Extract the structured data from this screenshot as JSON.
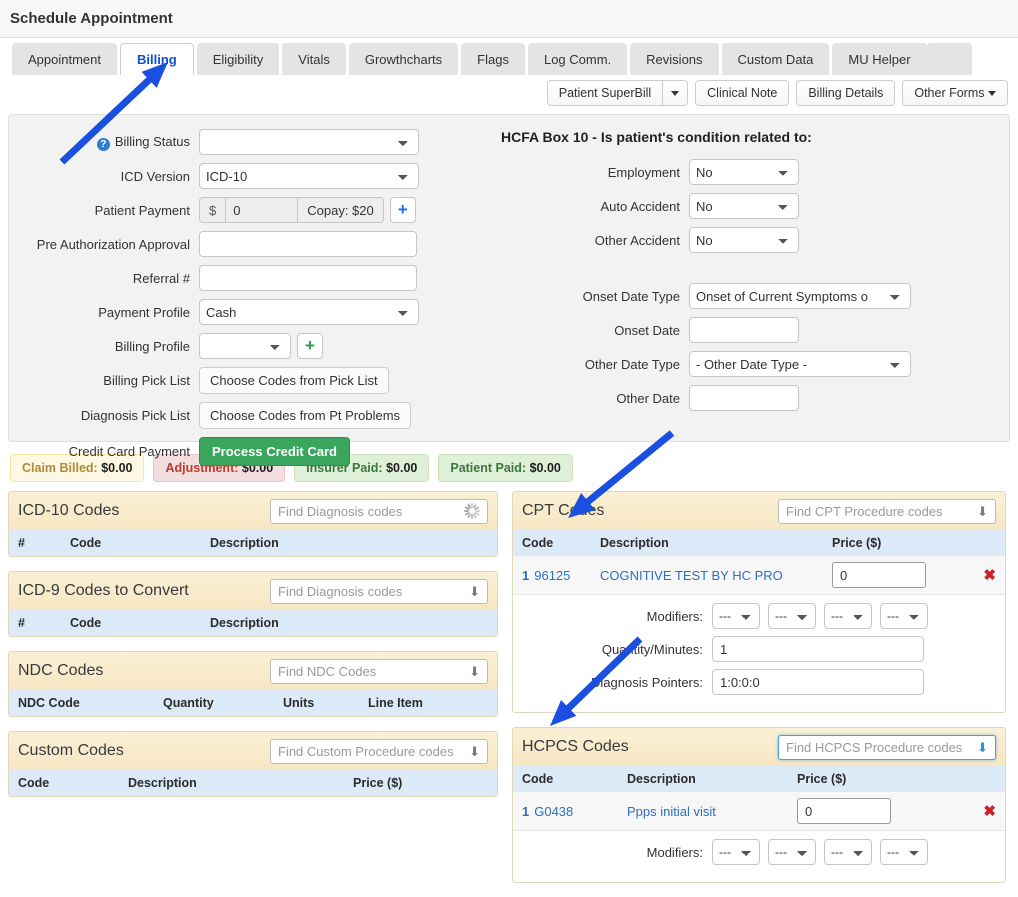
{
  "window": {
    "title": "Schedule Appointment"
  },
  "tabs": [
    {
      "label": "Appointment",
      "active": false
    },
    {
      "label": "Billing",
      "active": true
    },
    {
      "label": "Eligibility",
      "active": false
    },
    {
      "label": "Vitals",
      "active": false
    },
    {
      "label": "Growthcharts",
      "active": false
    },
    {
      "label": "Flags",
      "active": false
    },
    {
      "label": "Log Comm.",
      "active": false
    },
    {
      "label": "Revisions",
      "active": false
    },
    {
      "label": "Custom Data",
      "active": false
    },
    {
      "label": "MU Helper",
      "active": false
    }
  ],
  "toolbar": {
    "superbill_label": "Patient SuperBill",
    "superbill_caret": "▼",
    "clinical_note_label": "Clinical Note",
    "billing_details_label": "Billing Details",
    "other_forms_label": "Other Forms",
    "other_forms_caret": "▼"
  },
  "billing_form": {
    "help_icon_glyph": "?",
    "billing_status": {
      "label": "Billing Status",
      "value": ""
    },
    "icd_version": {
      "label": "ICD Version",
      "value": "ICD-10"
    },
    "patient_payment": {
      "label": "Patient Payment",
      "currency": "$",
      "value": "0",
      "copay_text": "Copay: $20",
      "add_glyph": "+"
    },
    "pre_auth": {
      "label": "Pre Authorization Approval",
      "value": ""
    },
    "referral": {
      "label": "Referral #",
      "value": ""
    },
    "payment_profile": {
      "label": "Payment Profile",
      "value": "Cash"
    },
    "billing_profile": {
      "label": "Billing Profile",
      "value": "",
      "add_glyph": "+"
    },
    "billing_pick_list": {
      "label": "Billing Pick List",
      "button": "Choose Codes from Pick List"
    },
    "diagnosis_pick_list": {
      "label": "Diagnosis Pick List",
      "button": "Choose Codes from Pt Problems"
    },
    "credit_card": {
      "label": "Credit Card Payment",
      "button": "Process Credit Card"
    }
  },
  "hcfa": {
    "title": "HCFA Box 10 - Is patient's condition related to:",
    "employment": {
      "label": "Employment",
      "value": "No"
    },
    "auto_accident": {
      "label": "Auto Accident",
      "value": "No"
    },
    "other_accident": {
      "label": "Other Accident",
      "value": "No"
    },
    "onset_date_type": {
      "label": "Onset Date Type",
      "value": "Onset of Current Symptoms o"
    },
    "onset_date": {
      "label": "Onset Date",
      "value": ""
    },
    "other_date_type": {
      "label": "Other Date Type",
      "value": "- Other Date Type -"
    },
    "other_date": {
      "label": "Other Date",
      "value": ""
    }
  },
  "badges": [
    {
      "label": "Claim Billed:",
      "amount": "$0.00",
      "kind": "claim"
    },
    {
      "label": "Adjustment:",
      "amount": "$0.00",
      "kind": "adj"
    },
    {
      "label": "Insurer Paid:",
      "amount": "$0.00",
      "kind": "ins"
    },
    {
      "label": "Patient Paid:",
      "amount": "$0.00",
      "kind": "pat"
    }
  ],
  "sections": {
    "icd10": {
      "title": "ICD-10 Codes",
      "search_placeholder": "Find Diagnosis codes",
      "headers": {
        "num": "#",
        "code": "Code",
        "description": "Description"
      },
      "rows": []
    },
    "icd9": {
      "title": "ICD-9 Codes to Convert",
      "search_placeholder": "Find Diagnosis codes",
      "headers": {
        "num": "#",
        "code": "Code",
        "description": "Description"
      },
      "rows": []
    },
    "ndc": {
      "title": "NDC Codes",
      "search_placeholder": "Find NDC Codes",
      "headers": {
        "code": "NDC Code",
        "quantity": "Quantity",
        "units": "Units",
        "line_item": "Line Item"
      },
      "rows": []
    },
    "custom": {
      "title": "Custom Codes",
      "search_placeholder": "Find Custom Procedure codes",
      "headers": {
        "code": "Code",
        "description": "Description",
        "price": "Price ($)"
      },
      "rows": []
    },
    "cpt": {
      "title": "CPT Codes",
      "search_placeholder": "Find CPT Procedure codes",
      "headers": {
        "code": "Code",
        "description": "Description",
        "price": "Price ($)"
      },
      "row": {
        "num": "1",
        "code": "96125",
        "description": "COGNITIVE TEST BY HC PRO",
        "price": "0",
        "remove_glyph": "✖"
      },
      "detail": {
        "modifiers_label": "Modifiers:",
        "modifier_values": [
          "---",
          "---",
          "---",
          "---"
        ],
        "quantity_label": "Quantity/Minutes:",
        "quantity_value": "1",
        "pointers_label": "Diagnosis Pointers:",
        "pointers_value": "1:0:0:0"
      }
    },
    "hcpcs": {
      "title": "HCPCS Codes",
      "search_placeholder": "Find HCPCS Procedure codes",
      "headers": {
        "code": "Code",
        "description": "Description",
        "price": "Price ($)"
      },
      "row": {
        "num": "1",
        "code": "G0438",
        "description": "Ppps initial visit",
        "price": "0",
        "remove_glyph": "✖"
      },
      "detail": {
        "modifiers_label": "Modifiers:",
        "modifier_values": [
          "---",
          "---",
          "---",
          "---"
        ]
      }
    }
  },
  "annotations": {
    "arrow_color": "#1a4fe0",
    "arrows": [
      {
        "name": "arrow-to-billing-tab",
        "from": [
          62,
          162
        ],
        "to": [
          168,
          62
        ]
      },
      {
        "name": "arrow-to-cpt-codes",
        "from": [
          672,
          433
        ],
        "to": [
          568,
          518
        ]
      },
      {
        "name": "arrow-to-hcpcs-codes",
        "from": [
          640,
          639
        ],
        "to": [
          550,
          726
        ]
      }
    ]
  }
}
